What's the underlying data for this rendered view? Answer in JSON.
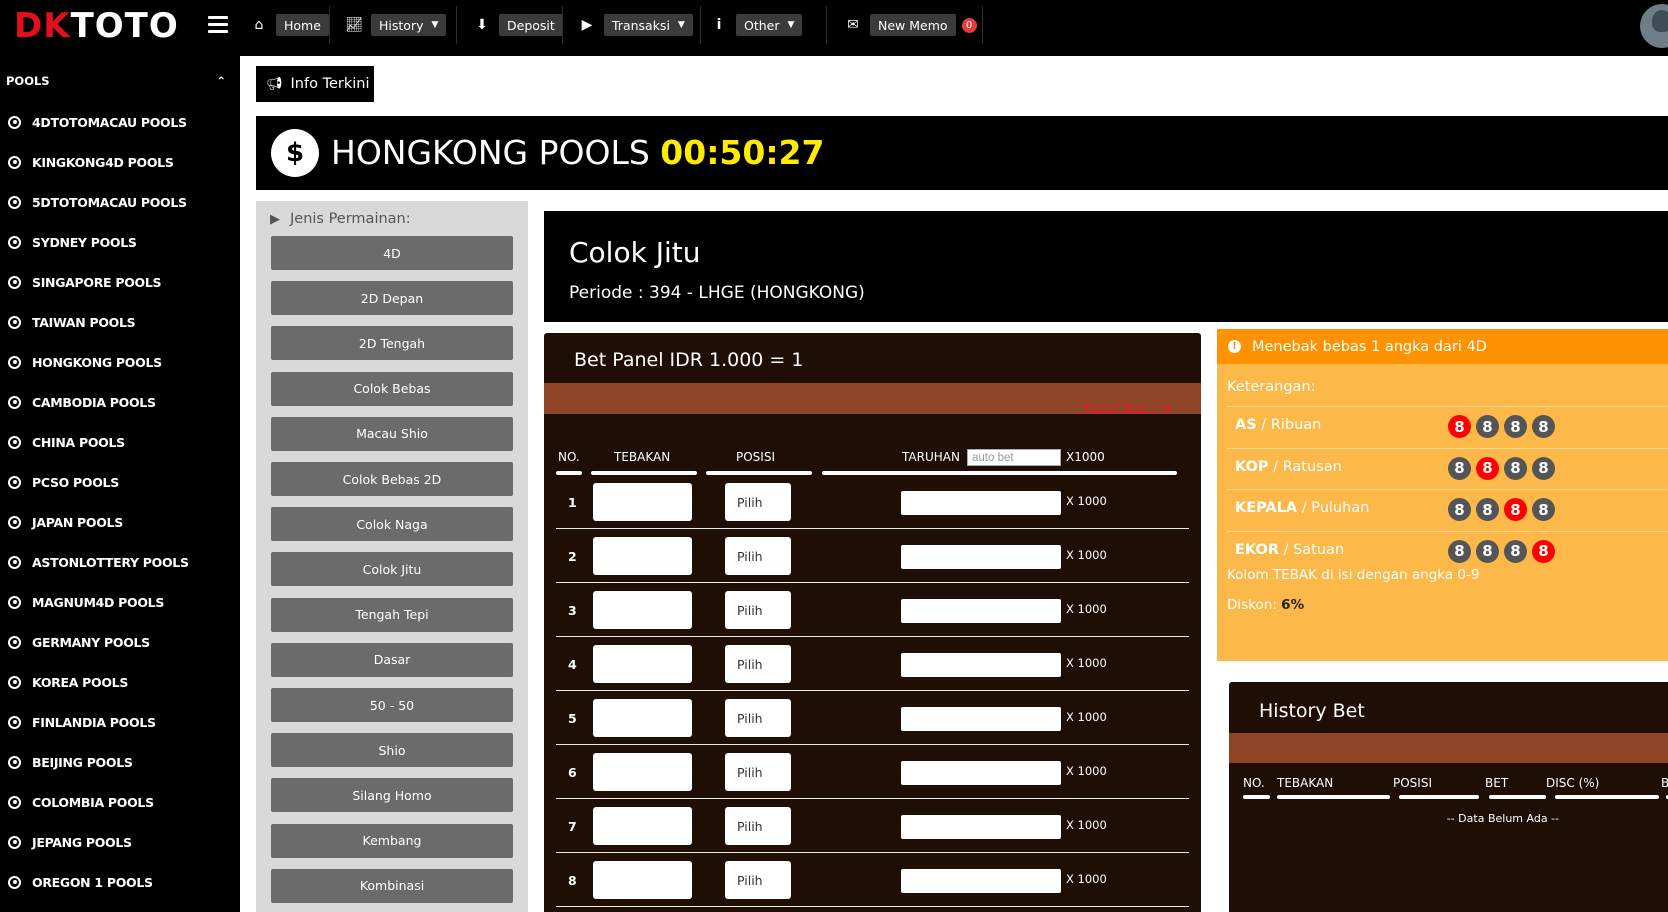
{
  "logo": {
    "part1": "DK",
    "part2": "TOTO"
  },
  "nav": {
    "home": "Home",
    "history": "History",
    "deposit": "Deposit",
    "transaksi": "Transaksi",
    "other": "Other",
    "memo": "New Memo",
    "memo_count": "0"
  },
  "sidebar": {
    "header": "POOLS",
    "items": [
      "4DTOTOMACAU POOLS",
      "KINGKONG4D POOLS",
      "5DTOTOMACAU POOLS",
      "SYDNEY POOLS",
      "SINGAPORE POOLS",
      "TAIWAN POOLS",
      "HONGKONG POOLS",
      "CAMBODIA POOLS",
      "CHINA POOLS",
      "PCSO POOLS",
      "JAPAN POOLS",
      "ASTONLOTTERY POOLS",
      "MAGNUM4D POOLS",
      "GERMANY POOLS",
      "KOREA POOLS",
      "FINLANDIA POOLS",
      "BEIJING POOLS",
      "COLOMBIA POOLS",
      "JEPANG POOLS",
      "OREGON 1 POOLS"
    ]
  },
  "info_button": "Info Terkini",
  "banner": {
    "title": "HONGKONG POOLS",
    "timer": "00:50:27"
  },
  "games": {
    "header": "Jenis Permainan:",
    "items": [
      "4D",
      "2D Depan",
      "2D Tengah",
      "Colok Bebas",
      "Macau Shio",
      "Colok Bebas 2D",
      "Colok Naga",
      "Colok Jitu",
      "Tengah Tepi",
      "Dasar",
      "50 - 50",
      "Shio",
      "Silang Homo",
      "Kembang",
      "Kombinasi"
    ]
  },
  "game_title": {
    "name": "Colok Jitu",
    "periode": "Periode : 394 - LHGE (HONGKONG)"
  },
  "bet_panel": {
    "title": "Bet Panel IDR 1.000 = 1",
    "total_bet": "Total Bet : 0",
    "headers": {
      "no": "NO.",
      "tebakan": "TEBAKAN",
      "posisi": "POSISI",
      "taruhan": "TARUHAN",
      "x1000": "X1000"
    },
    "autobet_placeholder": "auto bet",
    "rows": [
      {
        "no": "1",
        "pos": "Pilih",
        "x": "X 1000"
      },
      {
        "no": "2",
        "pos": "Pilih",
        "x": "X 1000"
      },
      {
        "no": "3",
        "pos": "Pilih",
        "x": "X 1000"
      },
      {
        "no": "4",
        "pos": "Pilih",
        "x": "X 1000"
      },
      {
        "no": "5",
        "pos": "Pilih",
        "x": "X 1000"
      },
      {
        "no": "6",
        "pos": "Pilih",
        "x": "X 1000"
      },
      {
        "no": "7",
        "pos": "Pilih",
        "x": "X 1000"
      },
      {
        "no": "8",
        "pos": "Pilih",
        "x": "X 1000"
      }
    ]
  },
  "info_panel": {
    "header": "Menebak bebas 1 angka dari 4D",
    "keterangan": "Keterangan:",
    "positions": [
      {
        "key": "AS",
        "sub": " / Ribuan",
        "balls": [
          "8",
          "8",
          "8",
          "8"
        ]
      },
      {
        "key": "KOP",
        "sub": " / Ratusan",
        "balls": [
          "8",
          "8",
          "8",
          "8"
        ]
      },
      {
        "key": "KEPALA",
        "sub": " / Puluhan",
        "balls": [
          "8",
          "8",
          "8",
          "8"
        ]
      },
      {
        "key": "EKOR",
        "sub": " / Satuan",
        "balls": [
          "8",
          "8",
          "8",
          "8"
        ]
      }
    ],
    "note": "Kolom TEBAK di isi dengan angka 0-9",
    "diskon_label": "Diskon: ",
    "diskon_value": "6%"
  },
  "history": {
    "title": "History Bet",
    "headers": {
      "no": "NO.",
      "tebakan": "TEBAKAN",
      "posisi": "POSISI",
      "bet": "BET",
      "disc": "DISC (%)",
      "b": "B"
    },
    "empty": "-- Data Belum Ada --"
  },
  "colors": {
    "accent_orange": "#ff9200",
    "panel_orange": "#fcb849",
    "timer_yellow": "#ffea00",
    "bet_brown": "#8f4426",
    "ball_red": "#ff0000"
  }
}
